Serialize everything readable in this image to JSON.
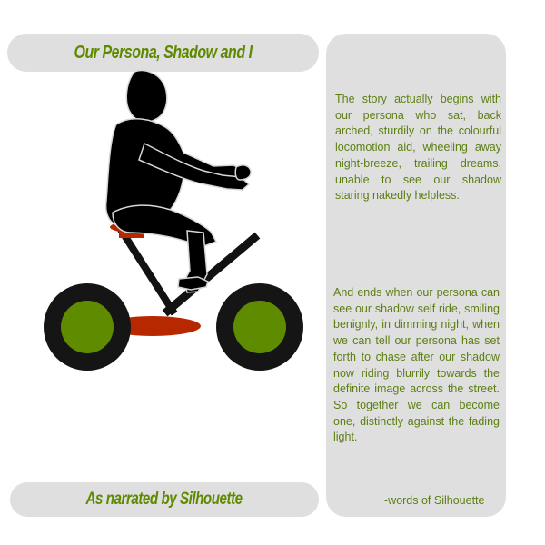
{
  "header": {
    "title": "Our Persona, Shadow and  I"
  },
  "footer": {
    "title": "As narrated by Silhouette"
  },
  "panel": {
    "story_begin": "The story actually begins with our persona who sat, back arched, sturdily on the colourful locomotion aid, wheeling away night-breeze, trailing dreams, unable to see our shadow staring nakedly helpless.",
    "story_end": "And ends when our persona can see our shadow self ride, smiling benignly, in dimming night, when we can tell our persona has set forth to chase after our shadow now riding blurrily towards the definite image across the street. So together we can become one, distinctly against the fading light.",
    "signature": "-words of Silhouette"
  },
  "colors": {
    "panel_bg": "#dfdfdf",
    "title_green": "#5f8a00",
    "text_green": "#5c7f12",
    "wheel_black": "#151515",
    "wheel_hub_green": "#5e8b00",
    "seat_red": "#b82800"
  }
}
